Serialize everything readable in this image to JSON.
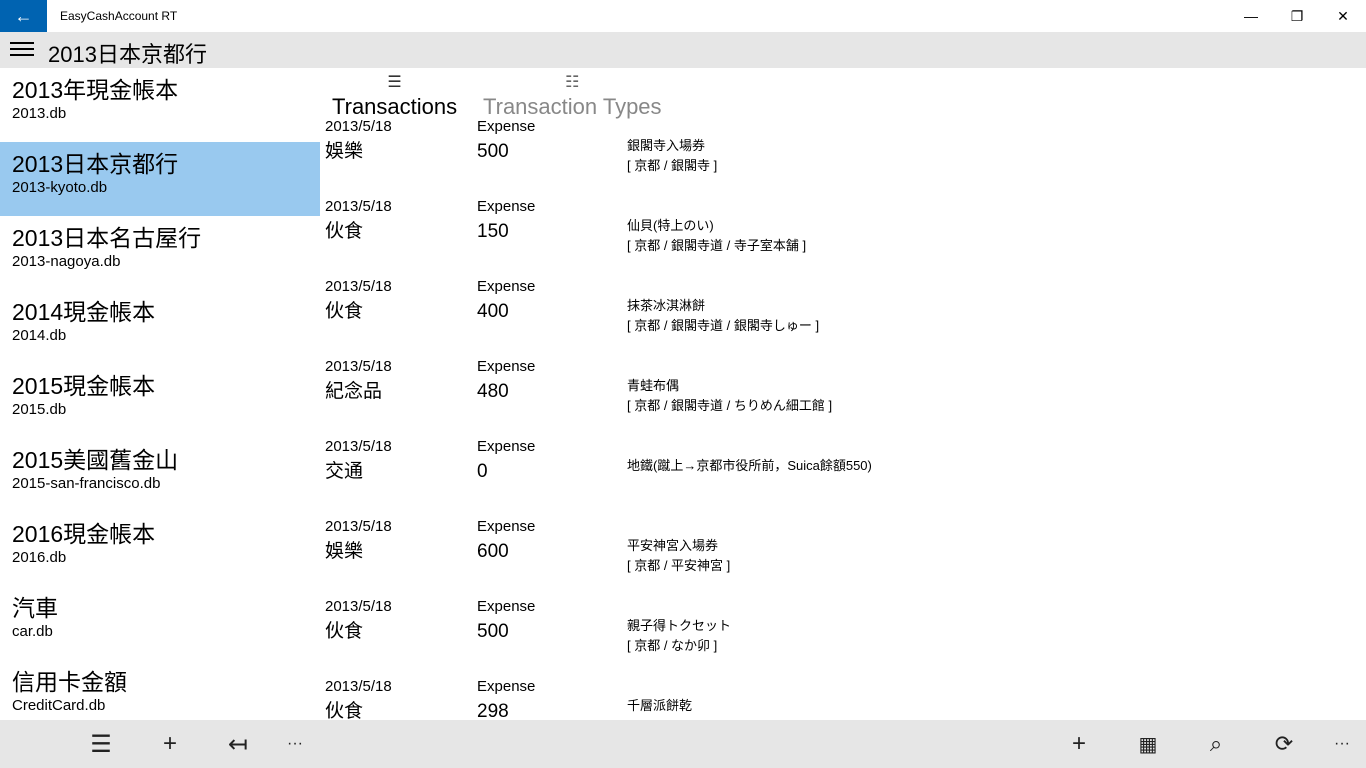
{
  "window": {
    "title": "EasyCashAccount RT"
  },
  "header": {
    "title": "2013日本京都行"
  },
  "sidebar": {
    "items": [
      {
        "name": "2013年現金帳本",
        "file": "2013.db"
      },
      {
        "name": "2013日本京都行",
        "file": "2013-kyoto.db",
        "selected": true
      },
      {
        "name": "2013日本名古屋行",
        "file": "2013-nagoya.db"
      },
      {
        "name": "2014現金帳本",
        "file": "2014.db"
      },
      {
        "name": "2015現金帳本",
        "file": "2015.db"
      },
      {
        "name": "2015美國舊金山",
        "file": "2015-san-francisco.db"
      },
      {
        "name": "2016現金帳本",
        "file": "2016.db"
      },
      {
        "name": "汽車",
        "file": "car.db"
      },
      {
        "name": "信用卡金額",
        "file": "CreditCard.db"
      }
    ]
  },
  "tabs": [
    {
      "label": "Transactions",
      "active": true,
      "icon": "list-icon"
    },
    {
      "label": "Transaction Types",
      "active": false,
      "icon": "checklist-icon"
    }
  ],
  "transactions": [
    {
      "date": "2013/5/18",
      "type": "Expense",
      "category": "娛樂",
      "amount": "500",
      "note": "銀閣寺入場券",
      "path": "[ 京都 / 銀閣寺 ]"
    },
    {
      "date": "2013/5/18",
      "type": "Expense",
      "category": "伙食",
      "amount": "150",
      "note": "仙貝(特上のい)",
      "path": "[ 京都 / 銀閣寺道 / 寺子室本舗 ]"
    },
    {
      "date": "2013/5/18",
      "type": "Expense",
      "category": "伙食",
      "amount": "400",
      "note": "抹茶冰淇淋餅",
      "path": "[ 京都 / 銀閣寺道 / 銀閣寺しゅー ]"
    },
    {
      "date": "2013/5/18",
      "type": "Expense",
      "category": "紀念品",
      "amount": "480",
      "note": "青蛙布偶",
      "path": "[ 京都 / 銀閣寺道 / ちりめん細工館 ]"
    },
    {
      "date": "2013/5/18",
      "type": "Expense",
      "category": "交通",
      "amount": "0",
      "note": "地鐵(蹴上→京都市役所前，Suica餘額550)",
      "path": ""
    },
    {
      "date": "2013/5/18",
      "type": "Expense",
      "category": "娛樂",
      "amount": "600",
      "note": "平安神宮入場券",
      "path": "[ 京都 / 平安神宮 ]"
    },
    {
      "date": "2013/5/18",
      "type": "Expense",
      "category": "伙食",
      "amount": "500",
      "note": "親子得トクセット",
      "path": "[ 京都 / なか卯 ]"
    },
    {
      "date": "2013/5/18",
      "type": "Expense",
      "category": "伙食",
      "amount": "298",
      "note": "千層派餅乾",
      "path": ""
    }
  ],
  "bottombar": {
    "left": [
      "list-icon",
      "add-icon",
      "back-arrow-icon",
      "more-icon"
    ],
    "right": [
      "add-icon",
      "calendar-icon",
      "search-icon",
      "refresh-icon",
      "more-icon"
    ],
    "more_label": "···"
  },
  "colors": {
    "accent": "#0063b1",
    "selected": "#99c9ef",
    "bar": "#e6e6e6"
  }
}
